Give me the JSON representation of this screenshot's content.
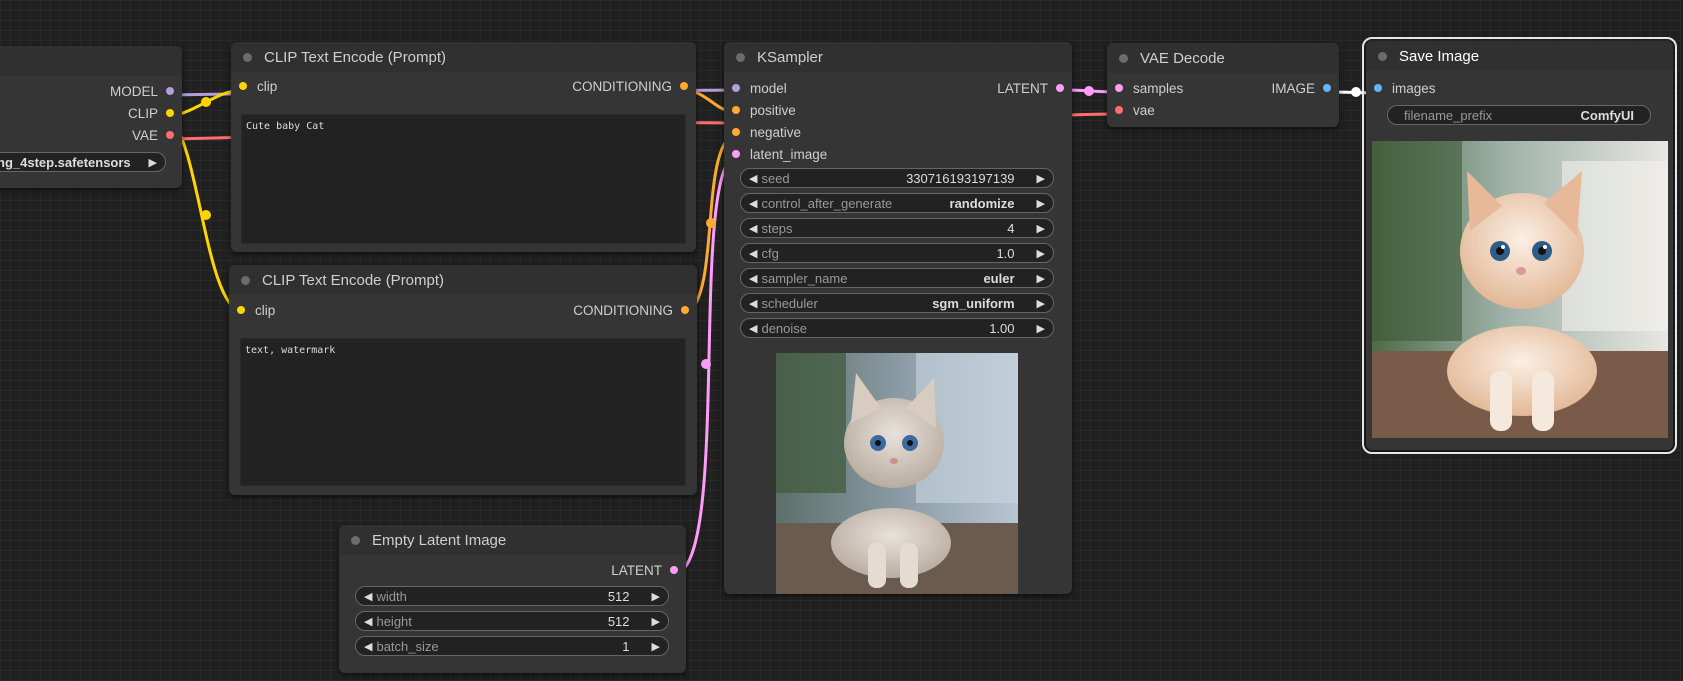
{
  "checkpoint_node": {
    "outputs": [
      "MODEL",
      "CLIP",
      "VAE"
    ],
    "ckpt_name": "ng_4step.safetensors"
  },
  "clip_pos": {
    "title": "CLIP Text Encode (Prompt)",
    "input": "clip",
    "output": "CONDITIONING",
    "text": "Cute baby Cat"
  },
  "clip_neg": {
    "title": "CLIP Text Encode (Prompt)",
    "input": "clip",
    "output": "CONDITIONING",
    "text": "text, watermark"
  },
  "empty_latent": {
    "title": "Empty Latent Image",
    "output": "LATENT",
    "widgets": [
      {
        "label": "width",
        "value": "512"
      },
      {
        "label": "height",
        "value": "512"
      },
      {
        "label": "batch_size",
        "value": "1"
      }
    ]
  },
  "ksampler": {
    "title": "KSampler",
    "inputs": [
      "model",
      "positive",
      "negative",
      "latent_image"
    ],
    "output": "LATENT",
    "widgets": [
      {
        "label": "seed",
        "value": "330716193197139"
      },
      {
        "label": "control_after_generate",
        "value": "randomize"
      },
      {
        "label": "steps",
        "value": "4"
      },
      {
        "label": "cfg",
        "value": "1.0"
      },
      {
        "label": "sampler_name",
        "value": "euler"
      },
      {
        "label": "scheduler",
        "value": "sgm_uniform"
      },
      {
        "label": "denoise",
        "value": "1.00"
      }
    ]
  },
  "vae_decode": {
    "title": "VAE Decode",
    "inputs": [
      "samples",
      "vae"
    ],
    "output": "IMAGE"
  },
  "save_image": {
    "title": "Save Image",
    "input": "images",
    "widget": {
      "label": "filename_prefix",
      "value": "ComfyUI"
    }
  },
  "colors": {
    "model": "#b39ddb",
    "clip": "#ffd500",
    "vae": "#ff6e6e",
    "conditioning": "#ffa931",
    "latent": "#ff9cf9",
    "image": "#64b5f6"
  },
  "icons": {
    "decrement": "left-triangle",
    "increment": "right-triangle",
    "combo": "right-triangle"
  }
}
